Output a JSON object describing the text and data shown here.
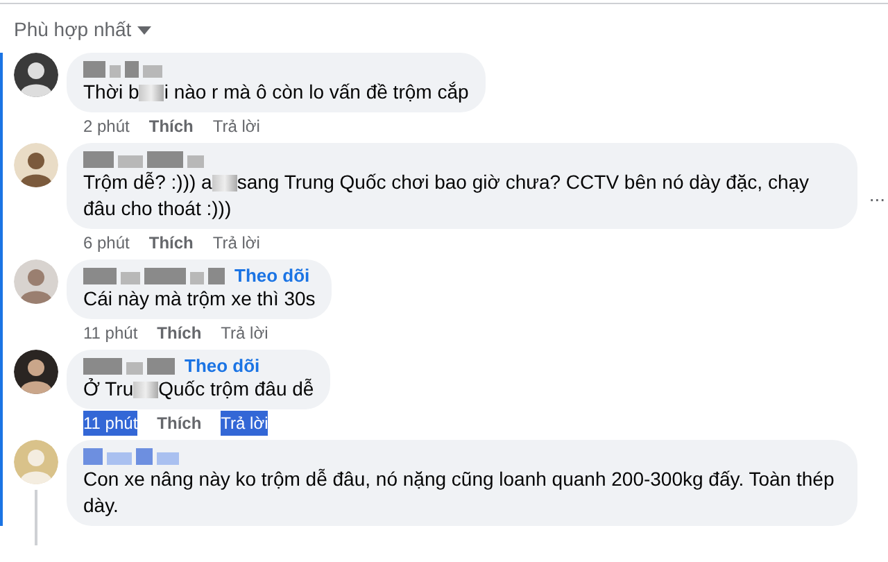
{
  "sort": {
    "label": "Phù hợp nhất"
  },
  "comments": [
    {
      "text_parts": [
        "Thời b",
        "i nào r mà ô còn lo vấn đề trộm cắp"
      ],
      "time": "2 phút",
      "like": "Thích",
      "reply": "Trả lời",
      "highlighted": false
    },
    {
      "text_parts": [
        "Trộm dễ? :))) a",
        "sang Trung Quốc chơi bao giờ chưa? CCTV bên nó dày đặc, chạy đâu cho thoát :)))"
      ],
      "time": "6 phút",
      "like": "Thích",
      "reply": "Trả lời",
      "more": "...",
      "highlighted": false
    },
    {
      "text_parts": [
        "Cái này mà trộm xe thì 30s"
      ],
      "follow": "Theo dõi",
      "time": "11 phút",
      "like": "Thích",
      "reply": "Trả lời",
      "highlighted": false
    },
    {
      "text_parts": [
        "Ở Tru",
        "Quốc trộm đâu dễ"
      ],
      "follow": "Theo dõi",
      "time": "11 phút",
      "like": "Thích",
      "reply": "Trả lời",
      "highlighted": true
    },
    {
      "text_parts": [
        "Con xe nâng này ko trộm dễ đâu, nó nặng cũng loanh quanh 200-300kg đấy. Toàn thép dày."
      ],
      "has_replies": true
    }
  ]
}
